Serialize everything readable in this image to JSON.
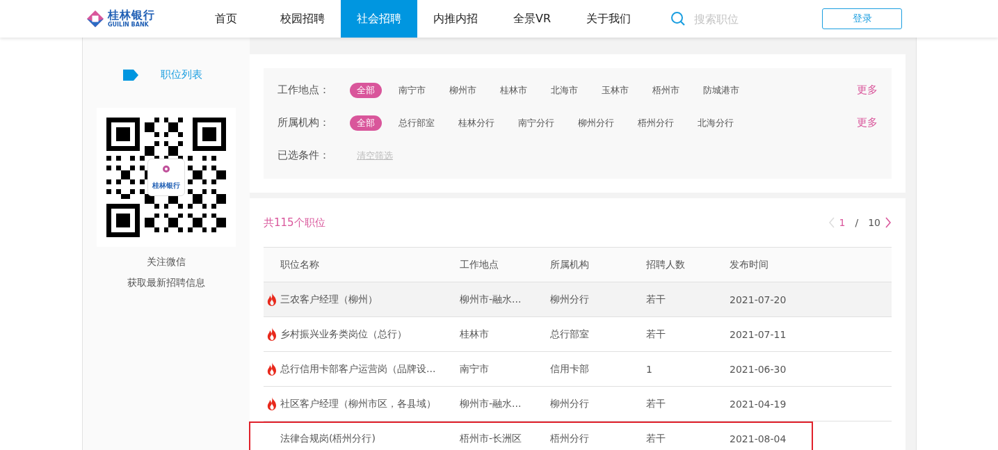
{
  "header": {
    "logo": {
      "name": "桂林银行",
      "subtitle": "GUILIN BANK"
    },
    "nav": [
      {
        "label": "首页",
        "selected": false
      },
      {
        "label": "校园招聘",
        "selected": false
      },
      {
        "label": "社会招聘",
        "selected": true
      },
      {
        "label": "内推内招",
        "selected": false
      },
      {
        "label": "全景VR",
        "selected": false
      },
      {
        "label": "关于我们",
        "selected": false
      }
    ],
    "search": {
      "placeholder": "搜索职位"
    },
    "login_button": "登录"
  },
  "sidebar": {
    "menu_item": {
      "label": "职位列表",
      "selected": true
    },
    "qr_logo": "桂林银行",
    "caption": [
      "关注微信",
      "获取最新招聘信息"
    ]
  },
  "filters": [
    {
      "label": "工作地点：",
      "more": "更多",
      "options": [
        {
          "label": "全部",
          "selected": true
        },
        {
          "label": "南宁市",
          "selected": false
        },
        {
          "label": "柳州市",
          "selected": false
        },
        {
          "label": "桂林市",
          "selected": false
        },
        {
          "label": "北海市",
          "selected": false
        },
        {
          "label": "玉林市",
          "selected": false
        },
        {
          "label": "梧州市",
          "selected": false
        },
        {
          "label": "防城港市",
          "selected": false
        }
      ]
    },
    {
      "label": "所属机构：",
      "more": "更多",
      "options": [
        {
          "label": "全部",
          "selected": true
        },
        {
          "label": "总行部室",
          "selected": false
        },
        {
          "label": "桂林分行",
          "selected": false
        },
        {
          "label": "南宁分行",
          "selected": false
        },
        {
          "label": "柳州分行",
          "selected": false
        },
        {
          "label": "梧州分行",
          "selected": false
        },
        {
          "label": "北海分行",
          "selected": false
        }
      ]
    }
  ],
  "selected_conditions": {
    "label": "已选条件：",
    "clear_link": "清空筛选"
  },
  "results": {
    "total": "共115个职位",
    "pagination": {
      "current": "1",
      "separator": "/",
      "total": "10"
    },
    "table": {
      "columns": [
        "职位名称",
        "工作地点",
        "所属机构",
        "招聘人数",
        "发布时间"
      ],
      "rows": [
        {
          "hot": true,
          "hovered": true,
          "highlighted": false,
          "cells": [
            "三农客户经理（柳州）",
            "柳州市-融水...",
            "柳州分行",
            "若干",
            "2021-07-20"
          ]
        },
        {
          "hot": true,
          "hovered": false,
          "highlighted": false,
          "cells": [
            "乡村振兴业务类岗位（总行）",
            "桂林市",
            "总行部室",
            "若干",
            "2021-07-11"
          ]
        },
        {
          "hot": true,
          "hovered": false,
          "highlighted": false,
          "cells": [
            "总行信用卡部客户运营岗（品牌设...",
            "南宁市",
            "信用卡部",
            "1",
            "2021-06-30"
          ]
        },
        {
          "hot": true,
          "hovered": false,
          "highlighted": false,
          "cells": [
            "社区客户经理（柳州市区，各县域）",
            "柳州市-融水...",
            "柳州分行",
            "若干",
            "2021-04-19"
          ]
        },
        {
          "hot": false,
          "hovered": false,
          "highlighted": true,
          "cells": [
            "法律合规岗(梧州分行)",
            "梧州市-长洲区",
            "梧州分行",
            "若干",
            "2021-08-04"
          ]
        }
      ]
    }
  }
}
